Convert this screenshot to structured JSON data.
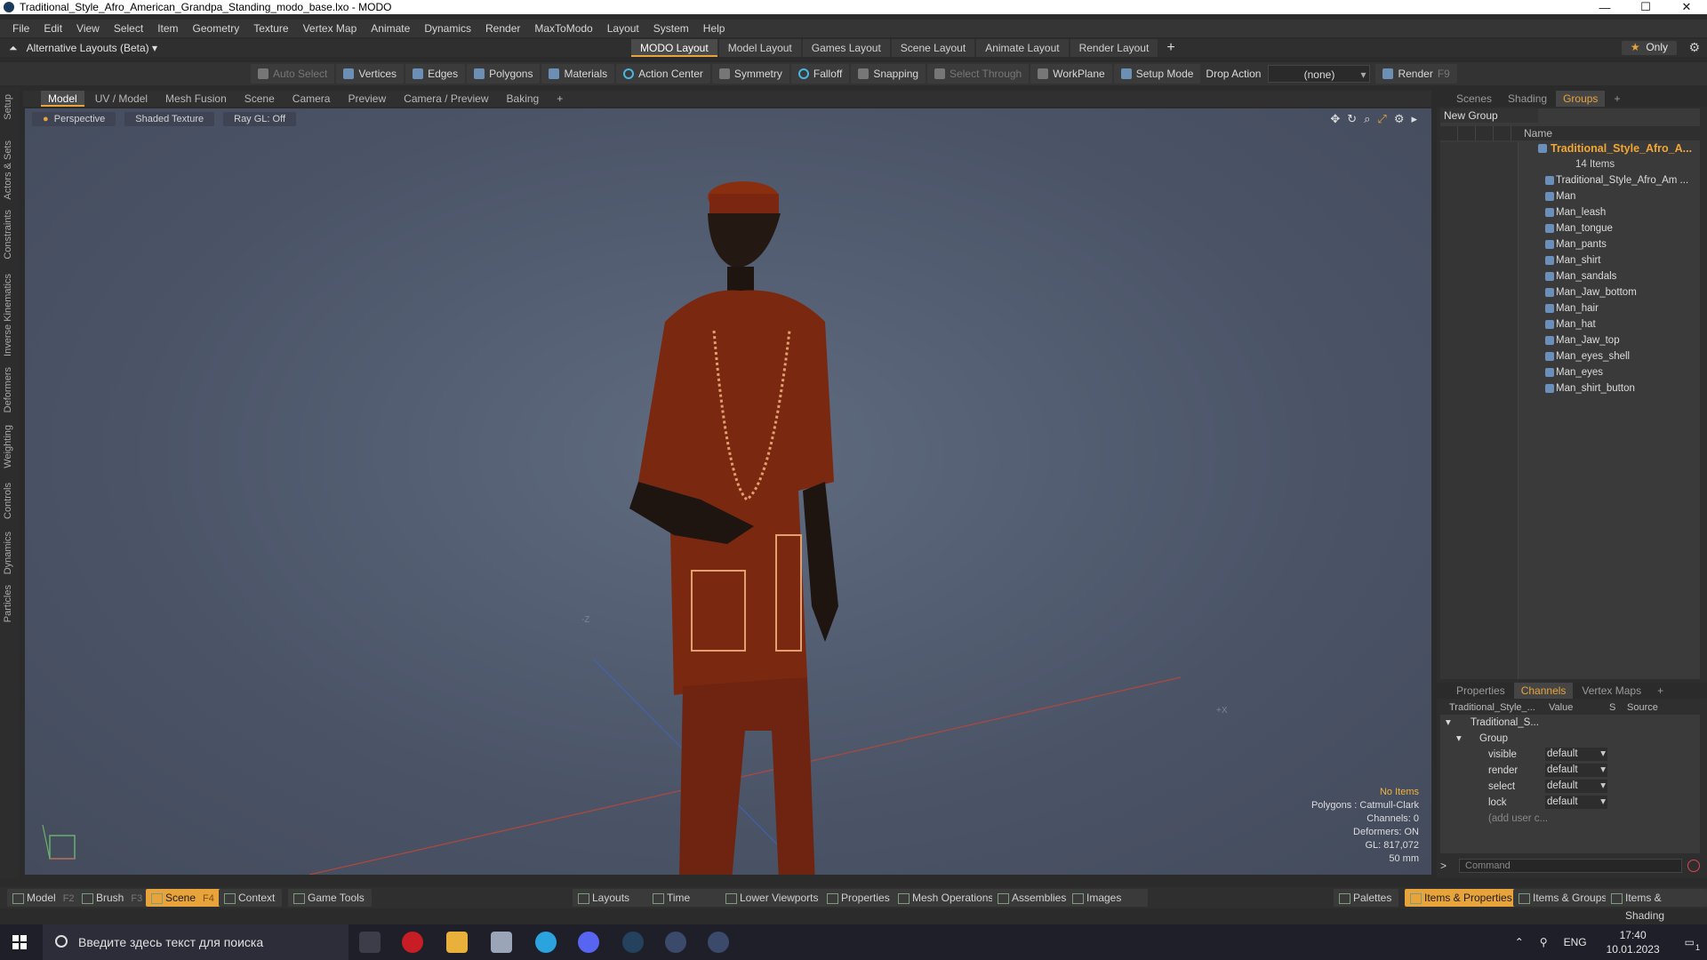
{
  "window": {
    "title": "Traditional_Style_Afro_American_Grandpa_Standing_modo_base.lxo - MODO"
  },
  "menu": [
    "File",
    "Edit",
    "View",
    "Select",
    "Item",
    "Geometry",
    "Texture",
    "Vertex Map",
    "Animate",
    "Dynamics",
    "Render",
    "MaxToModo",
    "Layout",
    "System",
    "Help"
  ],
  "layouts": {
    "alt": "Alternative Layouts (Beta)",
    "tabs": [
      "MODO Layout",
      "Model Layout",
      "Games Layout",
      "Scene Layout",
      "Animate Layout",
      "Render Layout"
    ],
    "only": "Only"
  },
  "toolbar": {
    "auto_select": "Auto Select",
    "vertices": "Vertices",
    "edges": "Edges",
    "polygons": "Polygons",
    "materials": "Materials",
    "action_center": "Action Center",
    "symmetry": "Symmetry",
    "falloff": "Falloff",
    "snapping": "Snapping",
    "select_through": "Select Through",
    "workplane": "WorkPlane",
    "setup_mode": "Setup Mode",
    "drop_action": "Drop Action",
    "drop_value": "(none)",
    "render": "Render",
    "render_key": "F9"
  },
  "left_strip": [
    "Setup",
    "Actors & Sets",
    "Constraints",
    "Inverse Kinematics",
    "Deformers",
    "Weighting",
    "Controls",
    "Dynamics",
    "Particles"
  ],
  "viewport_tabs": [
    "Model",
    "UV / Model",
    "Mesh Fusion",
    "Scene",
    "Camera",
    "Preview",
    "Camera / Preview",
    "Baking"
  ],
  "viewport": {
    "perspective": "Perspective",
    "shading": "Shaded Texture",
    "raygl": "Ray GL: Off",
    "axis_neg_z": "-Z",
    "axis_pos_x": "+X",
    "stats": {
      "no_items": "No Items",
      "polygons": "Polygons : Catmull-Clark",
      "channels": "Channels: 0",
      "deformers": "Deformers: ON",
      "gl": "GL: 817,072",
      "mm": "50 mm"
    }
  },
  "groups_panel": {
    "tabs": [
      "Scenes",
      "Shading",
      "Groups"
    ],
    "new_group": "New Group",
    "name_col": "Name",
    "group_name": "Traditional_Style_Afro_A...",
    "count": "14 Items",
    "items": [
      "Traditional_Style_Afro_Am ...",
      "Man",
      "Man_leash",
      "Man_tongue",
      "Man_pants",
      "Man_shirt",
      "Man_sandals",
      "Man_Jaw_bottom",
      "Man_hair",
      "Man_hat",
      "Man_Jaw_top",
      "Man_eyes_shell",
      "Man_eyes",
      "Man_shirt_button"
    ]
  },
  "channels_panel": {
    "tabs": [
      "Properties",
      "Channels",
      "Vertex Maps"
    ],
    "col_name": "Traditional_Style_...",
    "col_value": "Value",
    "col_s": "S",
    "col_source": "Source",
    "root": "Traditional_S...",
    "group": "Group",
    "rows": [
      {
        "name": "visible",
        "value": "default"
      },
      {
        "name": "render",
        "value": "default"
      },
      {
        "name": "select",
        "value": "default"
      },
      {
        "name": "lock",
        "value": "default"
      }
    ],
    "add_user": "(add user c...",
    "command_placeholder": "Command"
  },
  "bottom": {
    "model": "Model",
    "model_key": "F2",
    "brush": "Brush",
    "brush_key": "F3",
    "scene": "Scene",
    "scene_key": "F4",
    "context": "Context",
    "game_tools": "Game Tools",
    "layouts": "Layouts",
    "time": "Time",
    "lower_viewports": "Lower Viewports",
    "properties": "Properties",
    "mesh_operations": "Mesh Operations",
    "assemblies": "Assemblies",
    "images": "Images",
    "palettes": "Palettes",
    "items_properties": "Items & Properties",
    "items_groups": "Items & Groups",
    "items_shading": "Items & Shading"
  },
  "taskbar": {
    "search_placeholder": "Введите здесь текст для поиска",
    "lang": "ENG",
    "time": "17:40",
    "date": "10.01.2023",
    "badge": "1"
  },
  "colors": {
    "accent": "#e8a33a",
    "viewport_bg": "#4f586b",
    "cloth": "#7a2a10"
  }
}
